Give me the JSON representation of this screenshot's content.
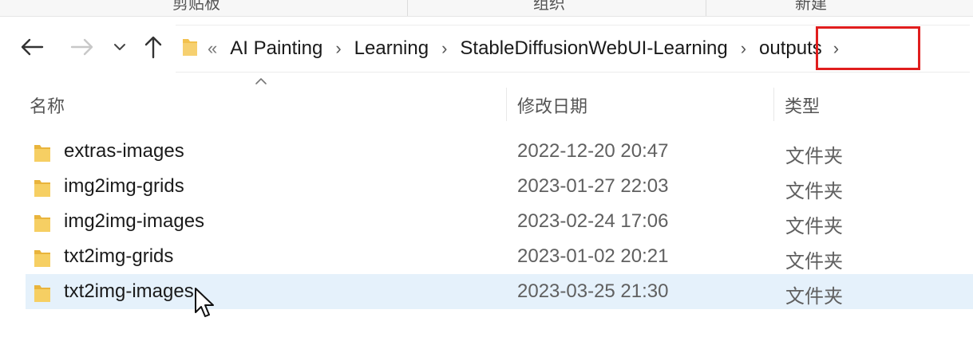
{
  "ribbon": {
    "groups": [
      "剪贴板",
      "组织",
      "新建"
    ]
  },
  "navigation": {
    "back_icon": "arrow-left-icon",
    "forward_icon": "arrow-right-icon",
    "recent_icon": "chevron-down-icon",
    "up_icon": "arrow-up-icon"
  },
  "address_bar": {
    "overflow": "«",
    "crumbs": [
      "AI Painting",
      "Learning",
      "StableDiffusionWebUI-Learning",
      "outputs"
    ],
    "highlight_color": "#e01e1e"
  },
  "columns": {
    "name": "名称",
    "modified": "修改日期",
    "type": "类型"
  },
  "files": [
    {
      "name": "extras-images",
      "modified": "2022-12-20 20:47",
      "type": "文件夹"
    },
    {
      "name": "img2img-grids",
      "modified": "2023-01-27 22:03",
      "type": "文件夹"
    },
    {
      "name": "img2img-images",
      "modified": "2023-02-24 17:06",
      "type": "文件夹"
    },
    {
      "name": "txt2img-grids",
      "modified": "2023-01-02 20:21",
      "type": "文件夹"
    },
    {
      "name": "txt2img-images",
      "modified": "2023-03-25 21:30",
      "type": "文件夹",
      "selected": true
    }
  ],
  "colors": {
    "folder": "#f2c14e",
    "selection": "#e5f1fb"
  }
}
